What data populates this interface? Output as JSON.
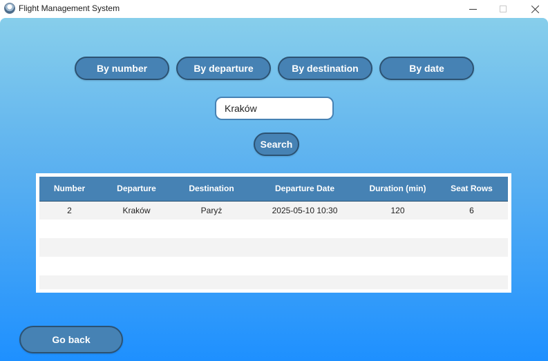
{
  "window": {
    "title": "Flight Management System",
    "icon": "globe-icon"
  },
  "colors": {
    "button_fill": "#4682b4",
    "button_border": "#2c5272",
    "background_top": "#87ceeb",
    "background_bottom": "#1e90ff"
  },
  "filters": [
    {
      "label": "By number"
    },
    {
      "label": "By departure"
    },
    {
      "label": "By destination"
    },
    {
      "label": "By date"
    }
  ],
  "search": {
    "value": "Kraków",
    "button_label": "Search"
  },
  "table": {
    "columns": [
      "Number",
      "Departure",
      "Destination",
      "Departure Date",
      "Duration (min)",
      "Seat Rows"
    ],
    "rows": [
      [
        "2",
        "Kraków",
        "Paryż",
        "2025-05-10 10:30",
        "120",
        "6"
      ]
    ]
  },
  "footer": {
    "back_label": "Go back"
  }
}
